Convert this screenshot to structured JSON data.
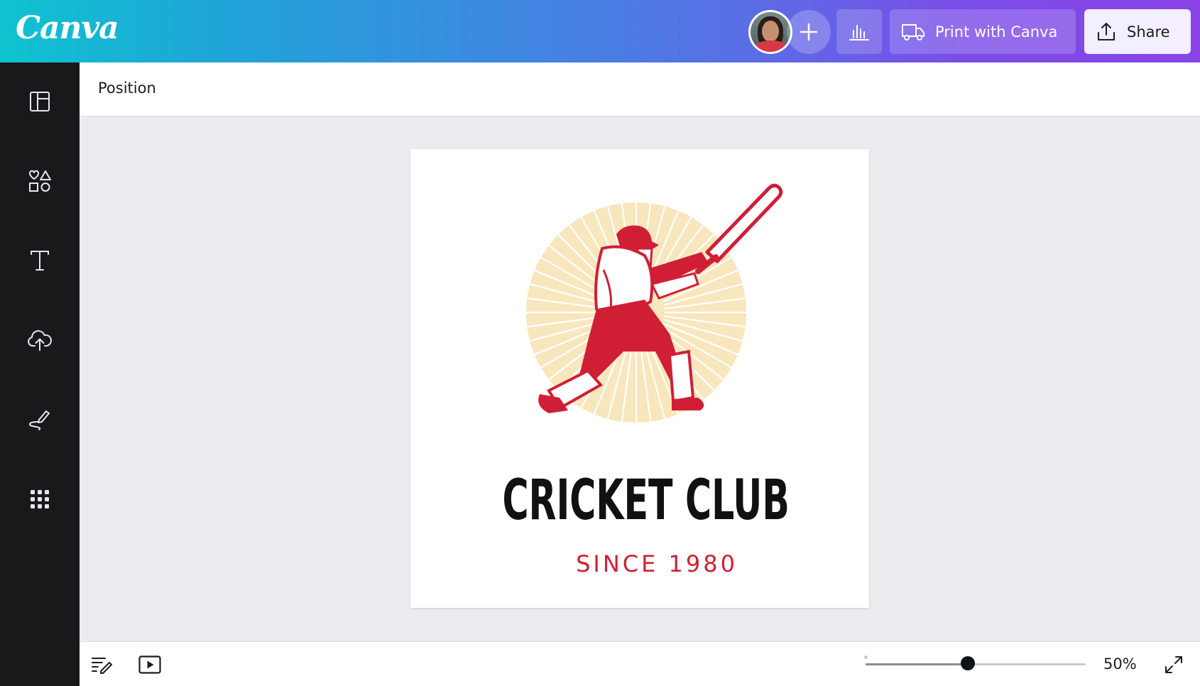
{
  "app": {
    "logo": "Canva"
  },
  "header": {
    "print_label": "Print with Canva",
    "share_label": "Share"
  },
  "sidebar": {
    "items": [
      {
        "icon": "layout-template-icon"
      },
      {
        "icon": "elements-shapes-icon"
      },
      {
        "icon": "text-icon"
      },
      {
        "icon": "upload-cloud-icon"
      },
      {
        "icon": "draw-pen-icon"
      },
      {
        "icon": "apps-grid-icon"
      }
    ]
  },
  "toolbar": {
    "position_label": "Position"
  },
  "design": {
    "title": "CRICKET CLUB",
    "subtitle": "SINCE 1980",
    "colors": {
      "red": "#d01f35",
      "sun": "#f7e3b4",
      "text": "#111111"
    }
  },
  "bottom": {
    "zoom_label": "50%",
    "zoom_fraction": 0.5
  }
}
